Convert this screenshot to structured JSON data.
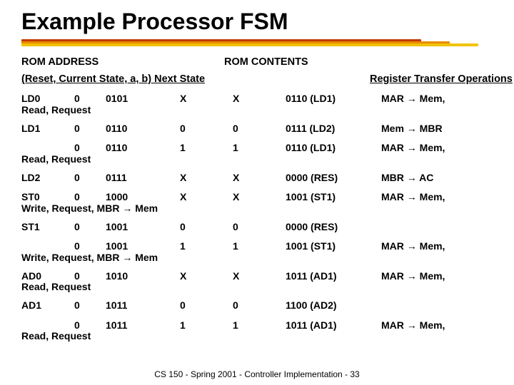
{
  "title": "Example Processor FSM",
  "header1": {
    "left": "ROM ADDRESS",
    "right": "ROM CONTENTS"
  },
  "header2": {
    "left": "(Reset, Current State, a, b) Next State",
    "mid": "",
    "reg": "Register Transfer Operations"
  },
  "rows": [
    {
      "c1": "LD0",
      "c2": "0",
      "c3": "0101",
      "c4": "X",
      "c5": "X",
      "c6": "0110 (LD1)",
      "c7": "MAR → Mem,",
      "below": "Read, Request"
    },
    {
      "c1": "LD1",
      "c2": "0",
      "c3": "0110",
      "c4": "0",
      "c5": "0",
      "c6": "0111 (LD2)",
      "c7": "Mem → MBR",
      "below": ""
    },
    {
      "c1": "",
      "c2": "0",
      "c3": "0110",
      "c4": "1",
      "c5": "1",
      "c6": "0110 (LD1)",
      "c7": "MAR → Mem,",
      "below": "Read, Request"
    },
    {
      "c1": "LD2",
      "c2": "0",
      "c3": "0111",
      "c4": "X",
      "c5": "X",
      "c6": "0000 (RES)",
      "c7": "MBR → AC",
      "below": ""
    },
    {
      "c1": "ST0",
      "c2": "0",
      "c3": "1000",
      "c4": "X",
      "c5": "X",
      "c6": "1001 (ST1)",
      "c7": "MAR → Mem,",
      "below": "Write, Request, MBR → Mem"
    },
    {
      "c1": "ST1",
      "c2": "0",
      "c3": "1001",
      "c4": "0",
      "c5": "0",
      "c6": "0000 (RES)",
      "c7": "",
      "below": ""
    },
    {
      "c1": "",
      "c2": "0",
      "c3": "1001",
      "c4": "1",
      "c5": "1",
      "c6": "1001 (ST1)",
      "c7": "MAR → Mem,",
      "below": "Write, Request, MBR → Mem"
    },
    {
      "c1": "AD0",
      "c2": "0",
      "c3": "1010",
      "c4": "X",
      "c5": "X",
      "c6": "1011 (AD1)",
      "c7": "MAR → Mem,",
      "below": "Read, Request"
    },
    {
      "c1": "AD1",
      "c2": "0",
      "c3": "1011",
      "c4": "0",
      "c5": "0",
      "c6": "1100 (AD2)",
      "c7": "",
      "below": ""
    },
    {
      "c1": "",
      "c2": "0",
      "c3": "1011",
      "c4": "1",
      "c5": "1",
      "c6": "1011 (AD1)",
      "c7": "MAR → Mem,",
      "below": "Read, Request"
    }
  ],
  "footer": "CS 150 - Spring 2001 - Controller Implementation - 33"
}
